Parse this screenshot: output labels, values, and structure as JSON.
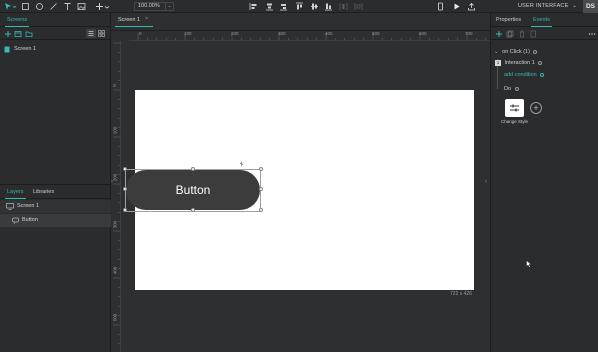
{
  "toolbar": {
    "zoom": "100.00%",
    "zoom_dropdown": "⌄",
    "ui_label": "USER INTERFACE",
    "ui_dropdown": "⌄",
    "avatar": "DS"
  },
  "left_panel": {
    "screens_tab": "Screens",
    "screens": [
      {
        "label": "Screen 1"
      }
    ],
    "layers_tab": "Layers",
    "libraries_tab": "Libraries",
    "layers": [
      {
        "label": "Screen 1"
      },
      {
        "label": "Button"
      }
    ]
  },
  "canvas": {
    "doc_tab": "Screen 1",
    "doc_tab_close": "×",
    "ruler_top": [
      "0",
      "100",
      "200",
      "300",
      "400",
      "500",
      "600",
      "700"
    ],
    "ruler_left": [
      "0",
      "100",
      "200",
      "300",
      "400",
      "500"
    ],
    "button_text": "Button",
    "dimensions": "722 x 426"
  },
  "right_panel": {
    "properties_tab": "Properties",
    "events_tab": "Events",
    "event_name": "on Click (1)",
    "interaction_number": "1",
    "interaction_label": "Interaction 1",
    "add_condition": "add condition",
    "do_label": "Do",
    "change_style_label": "Change Style",
    "add_action": "+"
  },
  "colors": {
    "accent": "#37b8b2",
    "panel_bg": "#2b2c2e",
    "canvas_bg": "#2e2f31",
    "button_bg": "#3c3c3c"
  }
}
